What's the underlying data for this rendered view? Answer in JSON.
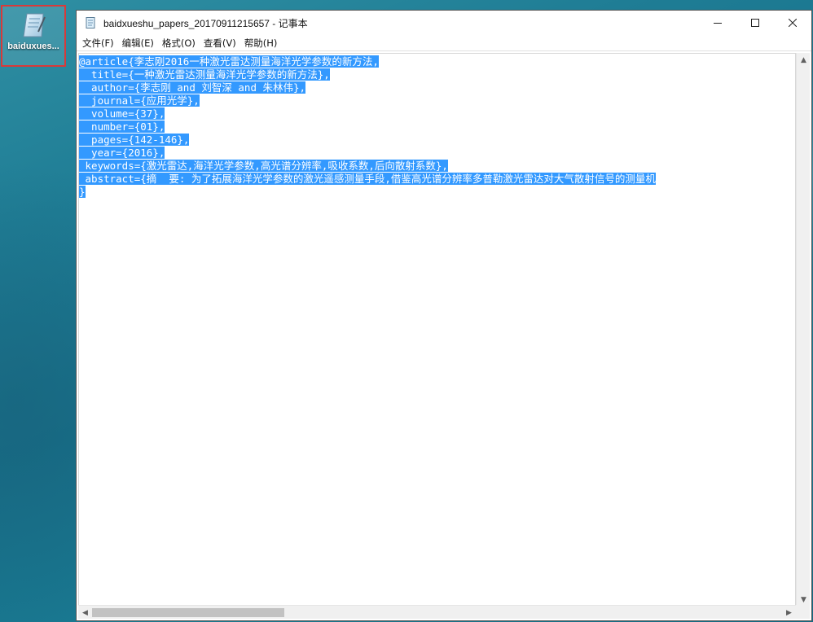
{
  "desktop": {
    "icon": {
      "label": "baiduxues...",
      "icon": "document-icon"
    }
  },
  "window": {
    "title": "baidxueshu_papers_20170911215657 - 记事本",
    "controls": [
      "minimize-icon",
      "maximize-icon",
      "close-icon"
    ]
  },
  "menu": {
    "items": [
      {
        "label": "文件(F)"
      },
      {
        "label": "编辑(E)"
      },
      {
        "label": "格式(O)"
      },
      {
        "label": "查看(V)"
      },
      {
        "label": "帮助(H)"
      }
    ]
  },
  "editor": {
    "lines": [
      "@article{李志刚2016一种激光雷达测量海洋光学参数的新方法,",
      "  title={一种激光雷达测量海洋光学参数的新方法},",
      "  author={李志刚 and 刘智深 and 朱林伟},",
      "  journal={应用光学},",
      "  volume={37},",
      "  number={01},",
      "  pages={142-146},",
      "  year={2016},",
      " keywords={激光雷达,海洋光学参数,高光谱分辨率,吸收系数,后向散射系数},",
      " abstract={摘  要: 为了拓展海洋光学参数的激光遥感测量手段,借鉴高光谱分辨率多普勒激光雷达对大气散射信号的测量机",
      "}"
    ],
    "selection": "all",
    "selection_color": "#3399ff"
  }
}
